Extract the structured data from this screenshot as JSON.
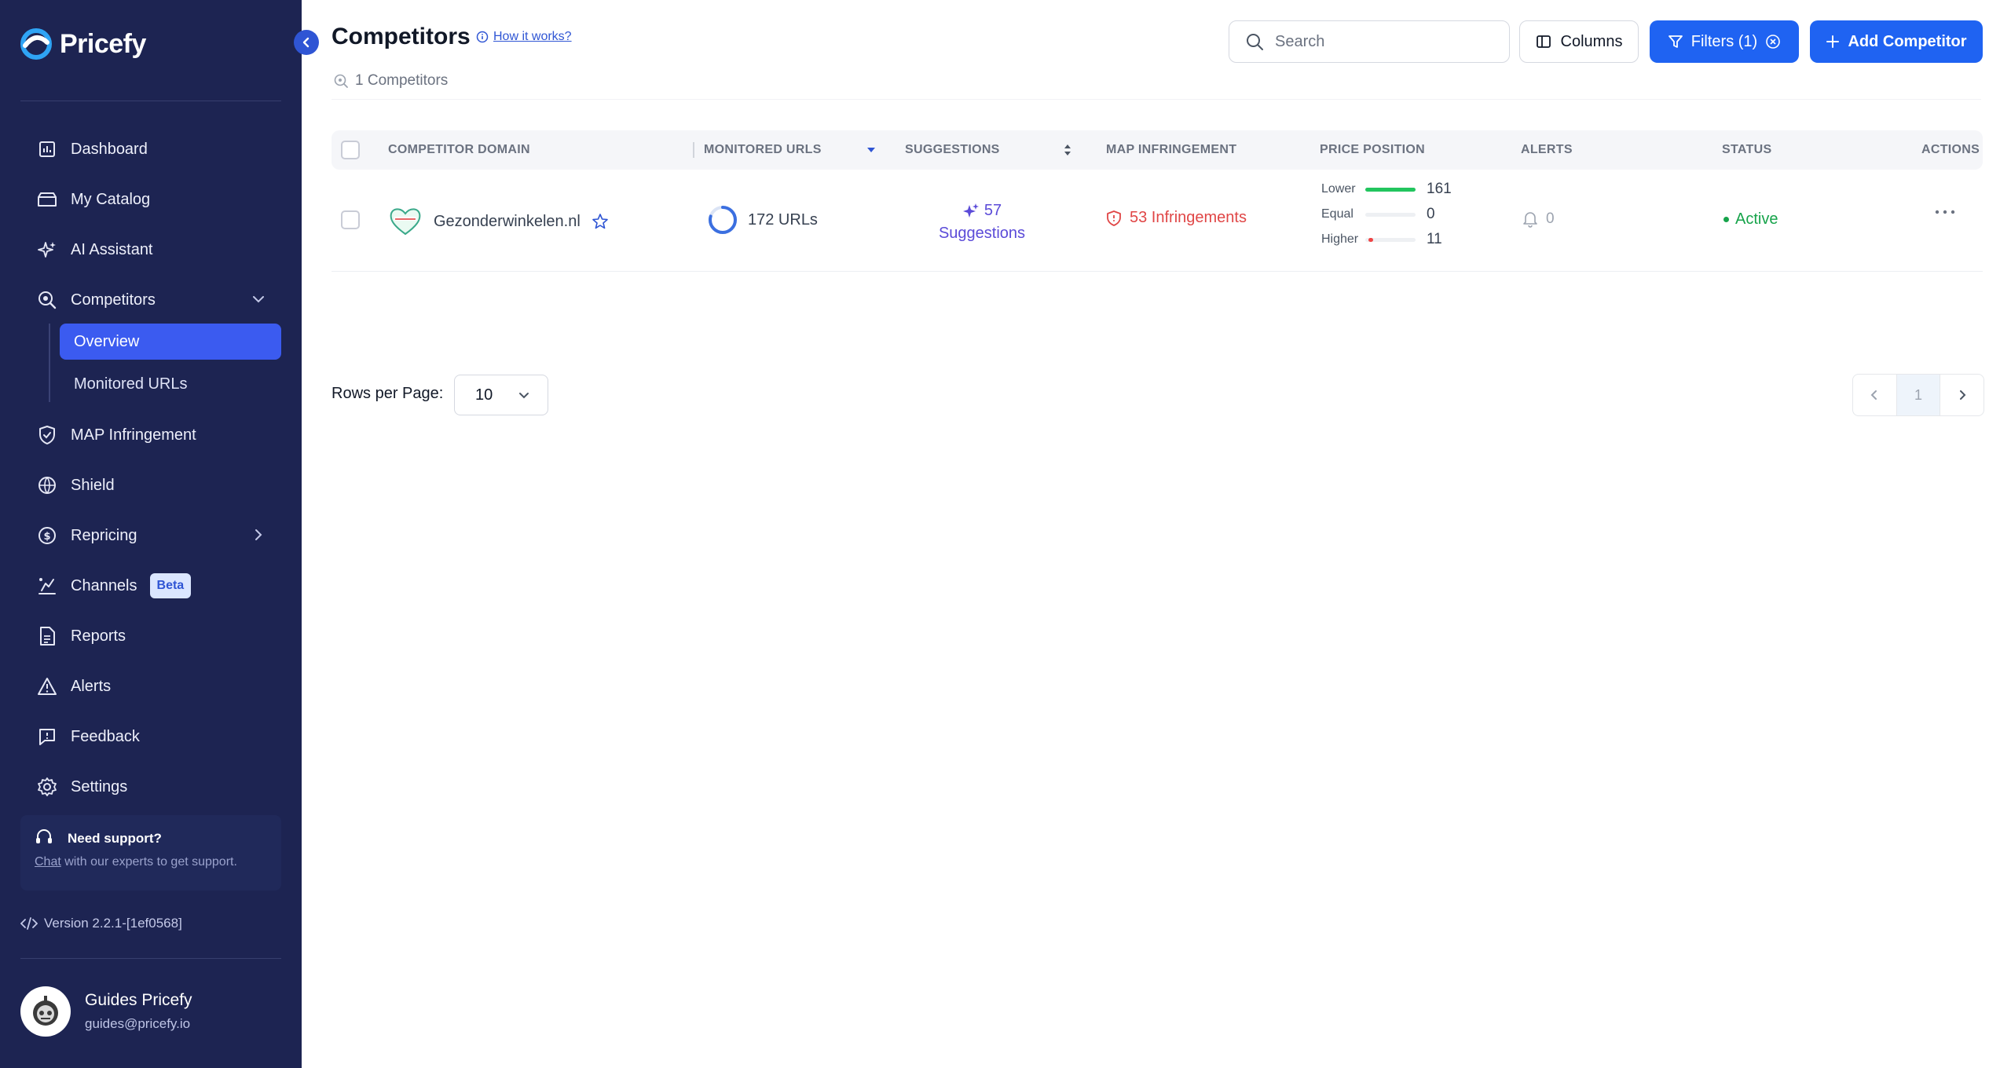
{
  "app": {
    "name": "Pricefy"
  },
  "sidebar": {
    "items": [
      {
        "label": "Dashboard",
        "icon": "dashboard-icon"
      },
      {
        "label": "My Catalog",
        "icon": "catalog-icon"
      },
      {
        "label": "AI Assistant",
        "icon": "sparkle-icon"
      },
      {
        "label": "Competitors",
        "icon": "competitors-icon"
      },
      {
        "label": "MAP Infringement",
        "icon": "shield-check-icon"
      },
      {
        "label": "Shield",
        "icon": "globe-icon"
      },
      {
        "label": "Repricing",
        "icon": "repricing-icon"
      },
      {
        "label": "Channels",
        "icon": "channels-icon",
        "badge": "Beta"
      },
      {
        "label": "Reports",
        "icon": "report-icon"
      },
      {
        "label": "Alerts",
        "icon": "alert-icon"
      },
      {
        "label": "Feedback",
        "icon": "feedback-icon"
      },
      {
        "label": "Settings",
        "icon": "settings-icon"
      }
    ],
    "competitors_sub": [
      {
        "label": "Overview",
        "active": true
      },
      {
        "label": "Monitored URLs",
        "active": false
      }
    ],
    "support": {
      "title": "Need support?",
      "link": "Chat",
      "text": " with our experts to get support."
    },
    "version": "Version 2.2.1-[1ef0568]",
    "user": {
      "name": "Guides Pricefy",
      "email": "guides@pricefy.io"
    }
  },
  "header": {
    "title": "Competitors",
    "how_link": "How it works?",
    "count": "1 Competitors",
    "search_placeholder": "Search",
    "columns_label": "Columns",
    "filters_label": "Filters (1)",
    "add_label": "Add Competitor"
  },
  "table": {
    "columns": [
      "COMPETITOR DOMAIN",
      "MONITORED URLS",
      "SUGGESTIONS",
      "MAP INFRINGEMENT",
      "PRICE POSITION",
      "ALERTS",
      "STATUS",
      "ACTIONS"
    ],
    "rows": [
      {
        "domain": "Gezonderwinkelen.nl",
        "urls": "172 URLs",
        "suggestions_count": "57",
        "suggestions_label": "Suggestions",
        "infringements": "53 Infringements",
        "price_position": [
          {
            "label": "Lower",
            "value": "161",
            "fill": 1.0,
            "color": "#22c55e"
          },
          {
            "label": "Equal",
            "value": "0",
            "fill": 0.0,
            "color": "#9ca3af"
          },
          {
            "label": "Higher",
            "value": "11",
            "fill": 0.07,
            "color": "#ef4444"
          }
        ],
        "alerts": "0",
        "status": "Active"
      }
    ]
  },
  "pagination": {
    "rows_label": "Rows per Page:",
    "rows_value": "10",
    "current_page": "1"
  },
  "colors": {
    "sidebar_bg": "#1d2452",
    "accent": "#1f63f2",
    "active_nav": "#3b5bf0",
    "danger": "#e04646",
    "success": "#16a34a",
    "suggestion": "#5b4bd8"
  }
}
